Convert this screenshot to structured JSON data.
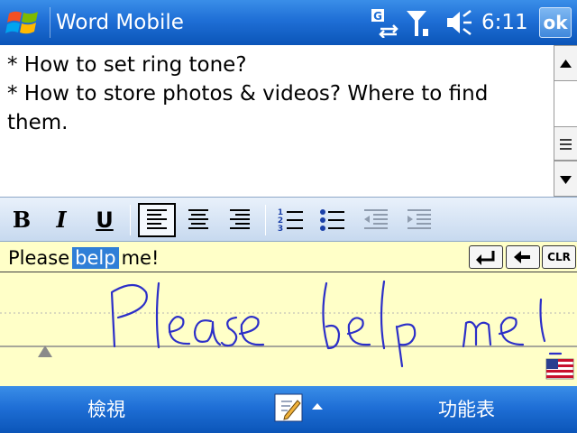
{
  "title_bar": {
    "app_title": "Word Mobile",
    "time": "6:11",
    "ok_label": "ok"
  },
  "document": {
    "lines": [
      "* How to set ring tone?",
      "* How to store photos & videos? Where to find",
      "them."
    ]
  },
  "toolbar": {
    "bold_label": "B",
    "italic_label": "I",
    "underline_label": "U",
    "numbered_digits": [
      "1",
      "2",
      "3"
    ]
  },
  "input_panel": {
    "recognized_words": [
      "Please",
      "belp",
      "me!"
    ],
    "selected_word_index": 1,
    "clear_label": "CLR",
    "handwriting_text": "Please belp me!"
  },
  "menu_bar": {
    "left_softkey": "檢視",
    "right_softkey": "功能表"
  },
  "colors": {
    "bar_blue": "#1f6fd6",
    "ink_blue": "#2c2fc8",
    "input_yellow": "#ffffc8",
    "selection_blue": "#2f7fd7"
  }
}
